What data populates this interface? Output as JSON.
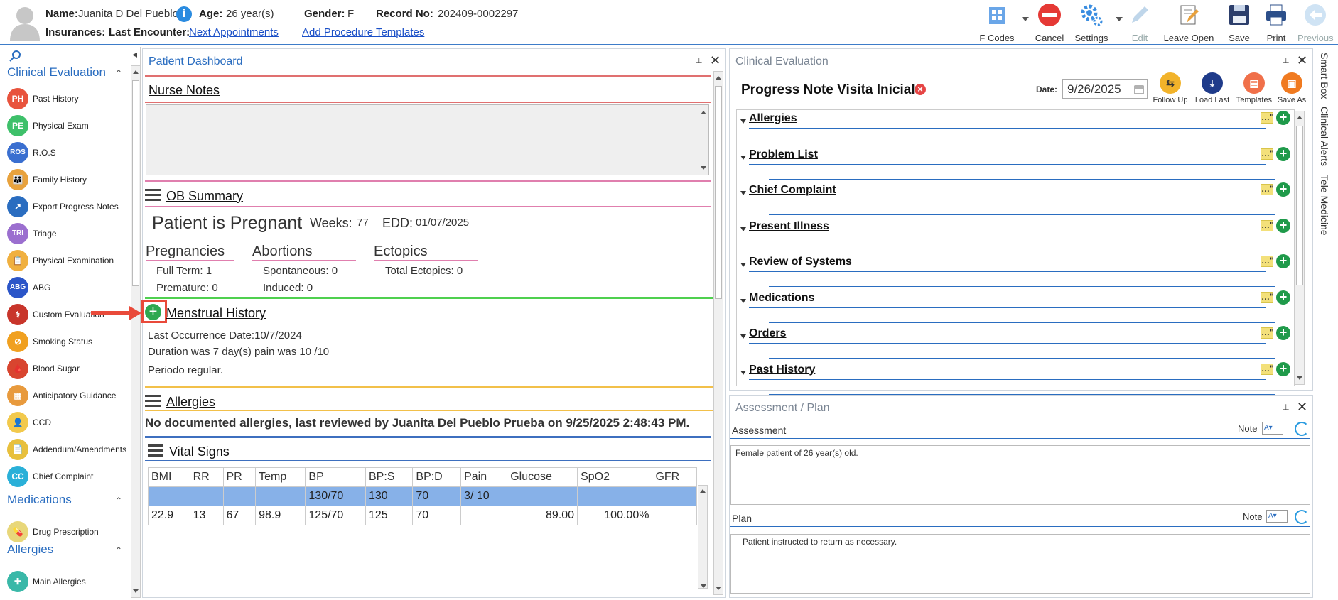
{
  "patient": {
    "name_label": "Name:",
    "name_value": "Juanita D Del Pueblo",
    "age_label": "Age:",
    "age_value": "26 year(s)",
    "gender_label": "Gender:",
    "gender_value": "F",
    "record_label": "Record No:",
    "record_value": "202409-0002297",
    "insurances_label": "Insurances:",
    "last_encounter_label": "Last Encounter:",
    "next_appointments_link": "Next Appointments",
    "add_procedure_link": "Add Procedure Templates",
    "info_glyph": "i"
  },
  "toolbar": {
    "fcodes": "F Codes",
    "cancel": "Cancel",
    "settings": "Settings",
    "edit": "Edit",
    "leave_open": "Leave Open",
    "save": "Save",
    "print": "Print",
    "previous": "Previous"
  },
  "leftnav": {
    "search_icon": "search-icon",
    "collapse_glyph": "◂",
    "sections": {
      "clinical": "Clinical Evaluation",
      "medications": "Medications",
      "allergies": "Allergies"
    },
    "items": [
      {
        "label": "Past History",
        "icon": "PH",
        "color": "#e8533d"
      },
      {
        "label": "Physical Exam",
        "icon": "PE",
        "color": "#3ec06a"
      },
      {
        "label": "R.O.S",
        "icon": "ROS",
        "color": "#3a6fd0"
      },
      {
        "label": "Family History",
        "icon": "👪",
        "color": "#e8a23d"
      },
      {
        "label": "Export Progress Notes",
        "icon": "↗",
        "color": "#2a6dc0"
      },
      {
        "label": "Triage",
        "icon": "TRI",
        "color": "#9b6fcf"
      },
      {
        "label": "Physical Examination",
        "icon": "📋",
        "color": "#f0b040"
      },
      {
        "label": "ABG",
        "icon": "ABG",
        "color": "#2b55c8"
      },
      {
        "label": "Custom Evaluation",
        "icon": "⚕",
        "color": "#c8352b"
      },
      {
        "label": "Smoking Status",
        "icon": "⊘",
        "color": "#f0a020"
      },
      {
        "label": "Blood Sugar",
        "icon": "🩸",
        "color": "#d8452f"
      },
      {
        "label": "Anticipatory Guidance",
        "icon": "▦",
        "color": "#e89a3d"
      },
      {
        "label": "CCD",
        "icon": "👤",
        "color": "#f2c94c"
      },
      {
        "label": "Addendum/Amendments",
        "icon": "📄",
        "color": "#e8c03d"
      },
      {
        "label": "Chief Complaint",
        "icon": "CC",
        "color": "#2ab0d8"
      },
      {
        "label": "Drug Prescription",
        "icon": "💊",
        "color": "#e8d77a"
      },
      {
        "label": "Main Allergies",
        "icon": "✚",
        "color": "#3ab8a8"
      }
    ],
    "chevron_up": "⌃"
  },
  "dashboard": {
    "title": "Patient Dashboard",
    "pin": "⊥",
    "close": "✕",
    "nurse_notes": "Nurse Notes",
    "ob_summary": "OB Summary",
    "pregnant_text": "Patient is Pregnant",
    "weeks_label": "Weeks:",
    "weeks_value": "77",
    "edd_label": "EDD:",
    "edd_value": "01/07/2025",
    "pregnancies": "Pregnancies",
    "full_term": "Full Term: 1",
    "premature": "Premature: 0",
    "abortions": "Abortions",
    "spontaneous": "Spontaneous: 0",
    "induced": "Induced: 0",
    "ectopics": "Ectopics",
    "total_ectopics": "Total Ectopics: 0",
    "menstrual_history": "Menstrual History",
    "last_occurrence": "Last Occurrence Date:10/7/2024",
    "duration": "Duration was 7 day(s) pain was 10 /10",
    "periodo": "Periodo regular.",
    "allergies": "Allergies",
    "allergies_text": "No documented allergies, last reviewed by Juanita Del Pueblo Prueba on 9/25/2025 2:48:43 PM.",
    "vital_signs": "Vital Signs",
    "vital_headers": [
      "BMI",
      "RR",
      "PR",
      "Temp",
      "BP",
      "BP:S",
      "BP:D",
      "Pain",
      "Glucose",
      "SpO2",
      "GFR"
    ],
    "vital_rows": [
      [
        "",
        "",
        "",
        "",
        "130/70",
        "130",
        "70",
        "3/ 10",
        "",
        "",
        ""
      ],
      [
        "22.9",
        "13",
        "67",
        "98.9",
        "125/70",
        "125",
        "70",
        "",
        "89.00",
        "100.00%",
        ""
      ]
    ],
    "plus_glyph": "+"
  },
  "clinical_eval": {
    "title": "Clinical Evaluation",
    "note_title": "Progress Note Visita Inicial",
    "date_label": "Date:",
    "date_value": "9/26/2025",
    "buttons": {
      "follow_up": "Follow Up",
      "load_last": "Load Last",
      "templates": "Templates",
      "save_as": "Save As"
    },
    "sections": [
      "Allergies",
      "Problem List",
      "Chief Complaint",
      "Present Illness",
      "Review of Systems",
      "Medications",
      "Orders",
      "Past History"
    ],
    "quote_glyph": "…\"",
    "plus_glyph": "+",
    "remove_glyph": "×"
  },
  "assessment_plan": {
    "title": "Assessment / Plan",
    "assessment_label": "Assessment",
    "note_label": "Note",
    "assessment_text": "Female patient of 26 year(s) old.",
    "plan_label": "Plan",
    "plan_text": "Patient instructed to return as necessary."
  },
  "side_tabs": {
    "smart_box": "Smart Box",
    "clinical_alerts": "Clinical Alerts",
    "tele_medicine": "Tele Medicine"
  },
  "colors": {
    "accent": "#2a6dc0",
    "highlight_row": "#87b1e8",
    "callout": "#e94a3a"
  }
}
